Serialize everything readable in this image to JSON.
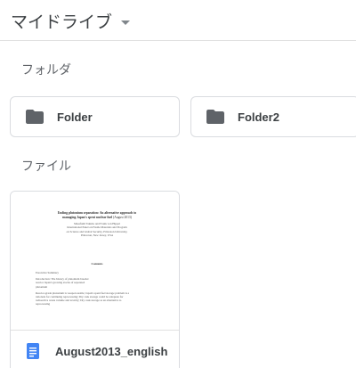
{
  "header": {
    "title": "マイドライブ",
    "dropdown_icon": "caret-down-icon"
  },
  "sections": {
    "folders_label": "フォルダ",
    "files_label": "ファイル"
  },
  "folders": [
    {
      "name": "Folder",
      "icon": "folder-icon"
    },
    {
      "name": "Folder2",
      "icon": "folder-icon"
    }
  ],
  "files": [
    {
      "name": "August2013_english",
      "icon": "google-docs-icon",
      "preview": {
        "title_line1": "Ending plutonium separation: An alternative approach to",
        "title_line2": "managing Japan's spent nuclear fuel",
        "title_suffix": "(August 2013)",
        "author": "Masafumi Takubo and Frank von Hippel",
        "affiliation1": "International Panel on Fissile Materials and Program",
        "affiliation2": "on Science and Global Security, Princeton University,",
        "affiliation3": "Princeton, New Jersey, USA",
        "contents_heading": "Contents",
        "toc": [
          "Executive Summary",
          "Introduction: The history of plutonium breeder",
          "reactor Japan's growing stocks of separated",
          "plutonium",
          "Reactor-grade plutonium is weapon usable; Japan's spent fuel storage problem is a",
          "rationale for continuing reprocessing; Dry cask storage could be adequate for",
          "radioactive waste volume and toxicity; Dry cask storage as an alternative to",
          "reprocessing"
        ]
      }
    }
  ],
  "colors": {
    "folder_icon": "#5f6368",
    "docs_icon": "#4285f4",
    "border": "#dadce0",
    "text": "#3c4043",
    "label": "#5f6368"
  }
}
